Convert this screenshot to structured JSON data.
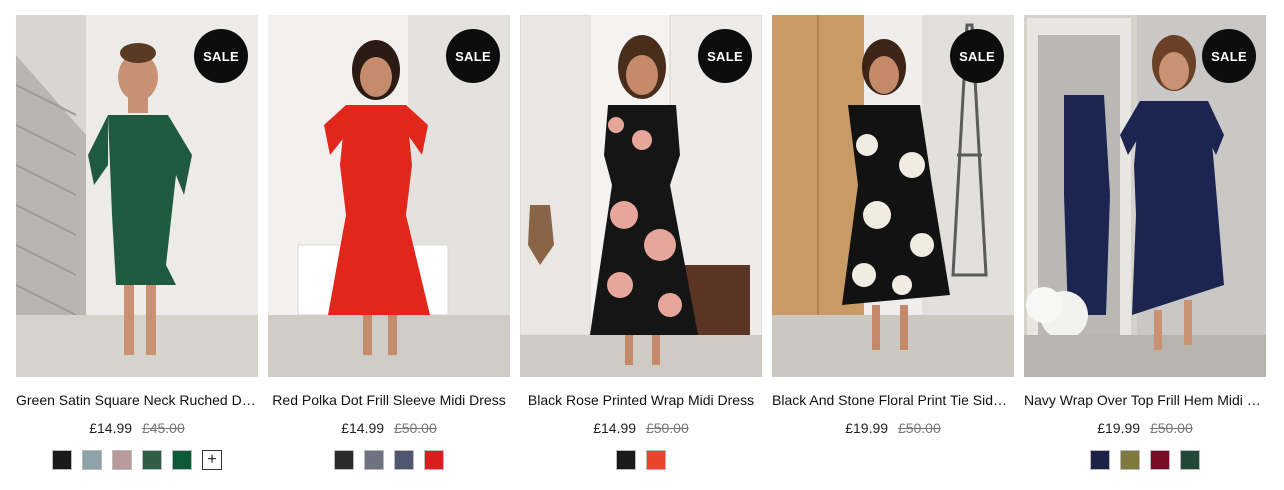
{
  "products": [
    {
      "badge": "SALE",
      "name": "Green Satin Square Neck Ruched Dress",
      "price_now": "£14.99",
      "price_was": "£45.00",
      "swatches": [
        "#1a1a1a",
        "#8ea3a8",
        "#b89a9a",
        "#2f5e45",
        "#0d5a36"
      ],
      "more_label": "+"
    },
    {
      "badge": "SALE",
      "name": "Red Polka Dot Frill Sleeve Midi Dress",
      "price_now": "£14.99",
      "price_was": "£50.00",
      "swatches": [
        "#2b2b2b",
        "#6f7380",
        "#4f5670",
        "#d91e1e"
      ]
    },
    {
      "badge": "SALE",
      "name": "Black Rose Printed Wrap Midi Dress",
      "price_now": "£14.99",
      "price_was": "£50.00",
      "swatches": [
        "#1a1a1a",
        "#e8452c"
      ]
    },
    {
      "badge": "SALE",
      "name": "Black And Stone Floral Print Tie Side Dress",
      "price_now": "£19.99",
      "price_was": "£50.00",
      "swatches": []
    },
    {
      "badge": "SALE",
      "name": "Navy Wrap Over Top Frill Hem Midi Dress",
      "price_now": "£19.99",
      "price_was": "£50.00",
      "swatches": [
        "#1c2347",
        "#7e7a3e",
        "#7a0d26",
        "#244838"
      ]
    }
  ],
  "colors": {
    "badge_bg": "#0d0d0d",
    "badge_text": "#ffffff",
    "dress_green": "#1f5a3f",
    "dress_red": "#e1261c",
    "dress_black_rose": "#151515",
    "dress_black_stone": "#121212",
    "dress_navy": "#1b2550"
  }
}
